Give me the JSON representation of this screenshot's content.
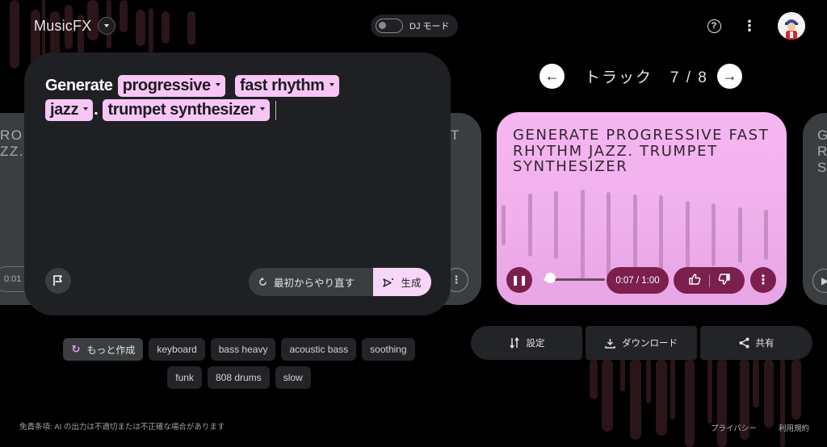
{
  "header": {
    "app_name": "MusicFX",
    "dj_mode_label": "DJ モード",
    "dj_mode_on": false,
    "help_icon": "help-circle-icon",
    "more_icon": "more-vert-icon",
    "avatar_icon": "user-avatar"
  },
  "prompt": {
    "prefix": "Generate",
    "chips": [
      {
        "label": "progressive"
      },
      {
        "label": "fast rhythm"
      },
      {
        "label": "jazz"
      },
      {
        "label": "trumpet synthesizer"
      }
    ],
    "separator": ".",
    "restart_label": "最初からやり直す",
    "generate_label": "生成"
  },
  "suggestions": {
    "more_label": "もっと作成",
    "chips": [
      "keyboard",
      "bass heavy",
      "acoustic bass",
      "soothing",
      "funk",
      "808 drums",
      "slow"
    ]
  },
  "track_nav": {
    "label": "トラック",
    "current": "7",
    "total": "8",
    "position_text": "7 / 8"
  },
  "side_cards": {
    "left_text": "RO\nZZ.",
    "left_time": "0:01",
    "middle_text": "T",
    "right_text": "G\nR\nS"
  },
  "track": {
    "title": "GENERATE PROGRESSIVE FAST RHYTHM JAZZ. TRUMPET SYNTHESIZER",
    "time_text": "0:07 / 1:00",
    "elapsed": "0:07",
    "duration": "1:00",
    "progress_fraction": 0.117,
    "waveform_levels": [
      0.45,
      0.7,
      0.75,
      1.0,
      0.95,
      0.9,
      0.88,
      0.75,
      0.7,
      0.62,
      0.55
    ],
    "playing": true
  },
  "actions": {
    "settings_label": "設定",
    "download_label": "ダウンロード",
    "share_label": "共有"
  },
  "footer": {
    "disclaimer": "免責条項: AI の出力は不適切または不正確な場合があります",
    "privacy_label": "プライバシー",
    "terms_label": "利用規約"
  },
  "colors": {
    "chip_pink": "#f7c6f7",
    "track_card": "#f6b6f2",
    "control_maroon": "#7b1f4e",
    "bg_bars": "#2a1519",
    "panel": "#1f2023"
  }
}
